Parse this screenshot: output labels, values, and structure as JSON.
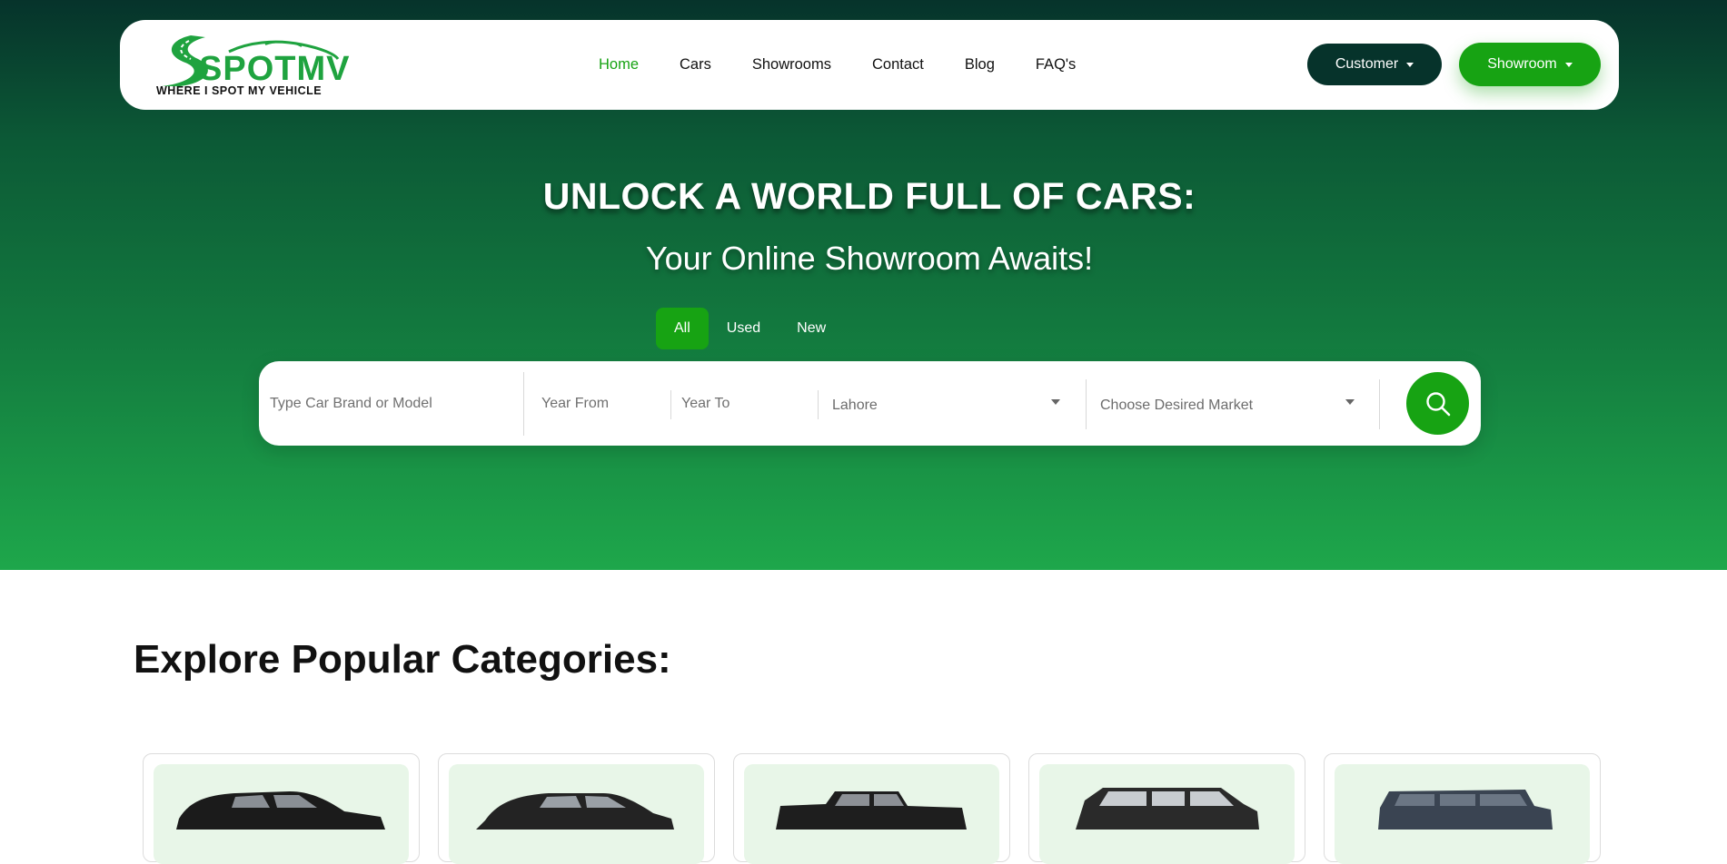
{
  "brand": {
    "logo_text": "SPOTMV",
    "tagline": "WHERE I SPOT MY VEHICLE",
    "accent_color": "#17a313",
    "dark_color": "#06332b"
  },
  "nav": {
    "links": [
      {
        "label": "Home",
        "active": true
      },
      {
        "label": "Cars",
        "active": false
      },
      {
        "label": "Showrooms",
        "active": false
      },
      {
        "label": "Contact",
        "active": false
      },
      {
        "label": "Blog",
        "active": false
      },
      {
        "label": "FAQ's",
        "active": false
      }
    ],
    "customer_label": "Customer",
    "showroom_label": "Showroom"
  },
  "hero": {
    "title": "UNLOCK A WORLD FULL OF CARS:",
    "subtitle": "Your Online Showroom Awaits!"
  },
  "tabs": [
    {
      "label": "All",
      "active": true
    },
    {
      "label": "Used",
      "active": false
    },
    {
      "label": "New",
      "active": false
    }
  ],
  "search": {
    "brand_placeholder": "Type Car Brand or Model",
    "year_from_placeholder": "Year From",
    "year_to_placeholder": "Year To",
    "city_value": "Lahore",
    "market_placeholder": "Choose Desired Market",
    "search_icon": "search-icon"
  },
  "categories": {
    "title": "Explore Popular Categories:",
    "cards": [
      "sedan-car-image",
      "hatchback-car-image",
      "pickup-truck-image",
      "suv-car-image",
      "jeep-car-image"
    ]
  }
}
